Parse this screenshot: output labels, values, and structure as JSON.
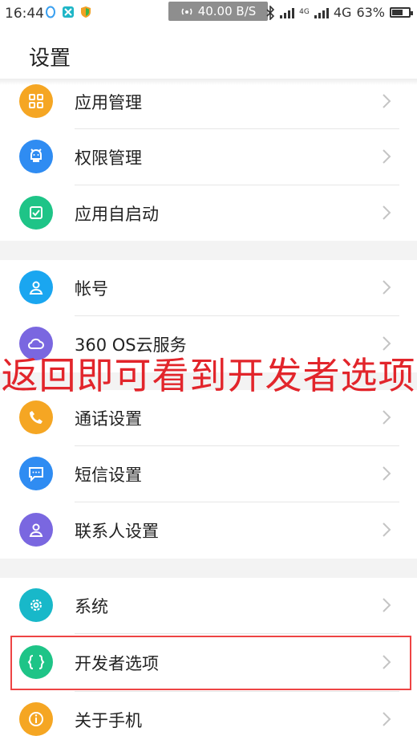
{
  "status_bar": {
    "time": "16:44",
    "network_speed": "40.00 B/S",
    "network_type": "4G",
    "network_type_small": "4G",
    "battery": "63%",
    "battery_level": 0.63,
    "icons": [
      "qq-icon",
      "app-icon",
      "shield-icon",
      "hotspot-icon",
      "bluetooth-icon",
      "signal-icon",
      "signal-icon",
      "battery-icon"
    ]
  },
  "header": {
    "title": "设置"
  },
  "menu": [
    {
      "label": "应用管理",
      "icon": "apps-grid-icon",
      "color": "#f5a623"
    },
    {
      "label": "权限管理",
      "icon": "android-robot-icon",
      "color": "#2f8cf2"
    },
    {
      "label": "应用自启动",
      "icon": "checkbox-icon",
      "color": "#1ec487"
    },
    {
      "label": "帐号",
      "icon": "person-icon",
      "color": "#1aa6f0"
    },
    {
      "label": "360 OS云服务",
      "icon": "cloud-icon",
      "color": "#7a67e0"
    },
    {
      "label": "通话设置",
      "icon": "phone-icon",
      "color": "#f5a623"
    },
    {
      "label": "短信设置",
      "icon": "message-icon",
      "color": "#2f8cf2"
    },
    {
      "label": "联系人设置",
      "icon": "contact-icon",
      "color": "#7a67e0"
    },
    {
      "label": "系统",
      "icon": "gear-icon",
      "color": "#18b8c9"
    },
    {
      "label": "开发者选项",
      "icon": "braces-icon",
      "color": "#1ec487"
    },
    {
      "label": "关于手机",
      "icon": "info-icon",
      "color": "#f5a623"
    }
  ],
  "overlay_caption": "返回即可看到开发者选项"
}
